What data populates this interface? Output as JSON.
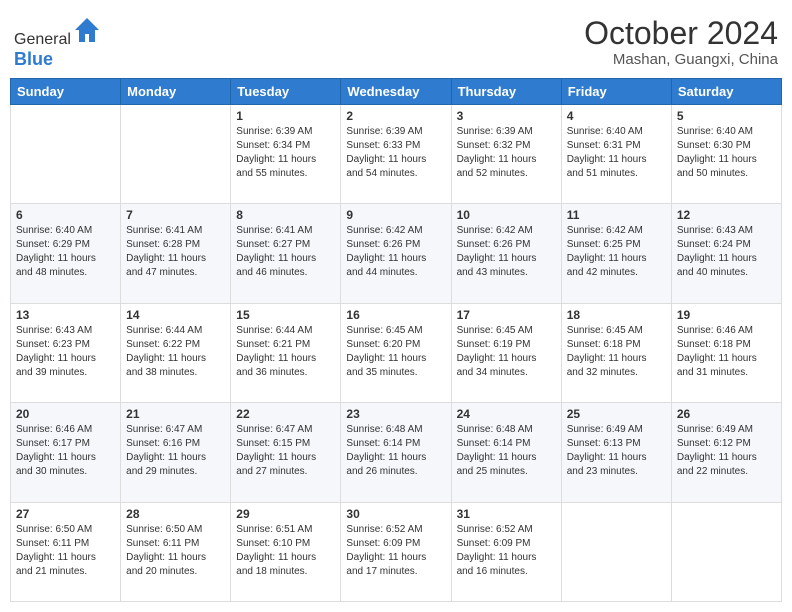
{
  "header": {
    "logo_general": "General",
    "logo_blue": "Blue",
    "month": "October 2024",
    "location": "Mashan, Guangxi, China"
  },
  "days_of_week": [
    "Sunday",
    "Monday",
    "Tuesday",
    "Wednesday",
    "Thursday",
    "Friday",
    "Saturday"
  ],
  "weeks": [
    [
      {
        "day": "",
        "sunrise": "",
        "sunset": "",
        "daylight": ""
      },
      {
        "day": "",
        "sunrise": "",
        "sunset": "",
        "daylight": ""
      },
      {
        "day": "1",
        "sunrise": "Sunrise: 6:39 AM",
        "sunset": "Sunset: 6:34 PM",
        "daylight": "Daylight: 11 hours and 55 minutes."
      },
      {
        "day": "2",
        "sunrise": "Sunrise: 6:39 AM",
        "sunset": "Sunset: 6:33 PM",
        "daylight": "Daylight: 11 hours and 54 minutes."
      },
      {
        "day": "3",
        "sunrise": "Sunrise: 6:39 AM",
        "sunset": "Sunset: 6:32 PM",
        "daylight": "Daylight: 11 hours and 52 minutes."
      },
      {
        "day": "4",
        "sunrise": "Sunrise: 6:40 AM",
        "sunset": "Sunset: 6:31 PM",
        "daylight": "Daylight: 11 hours and 51 minutes."
      },
      {
        "day": "5",
        "sunrise": "Sunrise: 6:40 AM",
        "sunset": "Sunset: 6:30 PM",
        "daylight": "Daylight: 11 hours and 50 minutes."
      }
    ],
    [
      {
        "day": "6",
        "sunrise": "Sunrise: 6:40 AM",
        "sunset": "Sunset: 6:29 PM",
        "daylight": "Daylight: 11 hours and 48 minutes."
      },
      {
        "day": "7",
        "sunrise": "Sunrise: 6:41 AM",
        "sunset": "Sunset: 6:28 PM",
        "daylight": "Daylight: 11 hours and 47 minutes."
      },
      {
        "day": "8",
        "sunrise": "Sunrise: 6:41 AM",
        "sunset": "Sunset: 6:27 PM",
        "daylight": "Daylight: 11 hours and 46 minutes."
      },
      {
        "day": "9",
        "sunrise": "Sunrise: 6:42 AM",
        "sunset": "Sunset: 6:26 PM",
        "daylight": "Daylight: 11 hours and 44 minutes."
      },
      {
        "day": "10",
        "sunrise": "Sunrise: 6:42 AM",
        "sunset": "Sunset: 6:26 PM",
        "daylight": "Daylight: 11 hours and 43 minutes."
      },
      {
        "day": "11",
        "sunrise": "Sunrise: 6:42 AM",
        "sunset": "Sunset: 6:25 PM",
        "daylight": "Daylight: 11 hours and 42 minutes."
      },
      {
        "day": "12",
        "sunrise": "Sunrise: 6:43 AM",
        "sunset": "Sunset: 6:24 PM",
        "daylight": "Daylight: 11 hours and 40 minutes."
      }
    ],
    [
      {
        "day": "13",
        "sunrise": "Sunrise: 6:43 AM",
        "sunset": "Sunset: 6:23 PM",
        "daylight": "Daylight: 11 hours and 39 minutes."
      },
      {
        "day": "14",
        "sunrise": "Sunrise: 6:44 AM",
        "sunset": "Sunset: 6:22 PM",
        "daylight": "Daylight: 11 hours and 38 minutes."
      },
      {
        "day": "15",
        "sunrise": "Sunrise: 6:44 AM",
        "sunset": "Sunset: 6:21 PM",
        "daylight": "Daylight: 11 hours and 36 minutes."
      },
      {
        "day": "16",
        "sunrise": "Sunrise: 6:45 AM",
        "sunset": "Sunset: 6:20 PM",
        "daylight": "Daylight: 11 hours and 35 minutes."
      },
      {
        "day": "17",
        "sunrise": "Sunrise: 6:45 AM",
        "sunset": "Sunset: 6:19 PM",
        "daylight": "Daylight: 11 hours and 34 minutes."
      },
      {
        "day": "18",
        "sunrise": "Sunrise: 6:45 AM",
        "sunset": "Sunset: 6:18 PM",
        "daylight": "Daylight: 11 hours and 32 minutes."
      },
      {
        "day": "19",
        "sunrise": "Sunrise: 6:46 AM",
        "sunset": "Sunset: 6:18 PM",
        "daylight": "Daylight: 11 hours and 31 minutes."
      }
    ],
    [
      {
        "day": "20",
        "sunrise": "Sunrise: 6:46 AM",
        "sunset": "Sunset: 6:17 PM",
        "daylight": "Daylight: 11 hours and 30 minutes."
      },
      {
        "day": "21",
        "sunrise": "Sunrise: 6:47 AM",
        "sunset": "Sunset: 6:16 PM",
        "daylight": "Daylight: 11 hours and 29 minutes."
      },
      {
        "day": "22",
        "sunrise": "Sunrise: 6:47 AM",
        "sunset": "Sunset: 6:15 PM",
        "daylight": "Daylight: 11 hours and 27 minutes."
      },
      {
        "day": "23",
        "sunrise": "Sunrise: 6:48 AM",
        "sunset": "Sunset: 6:14 PM",
        "daylight": "Daylight: 11 hours and 26 minutes."
      },
      {
        "day": "24",
        "sunrise": "Sunrise: 6:48 AM",
        "sunset": "Sunset: 6:14 PM",
        "daylight": "Daylight: 11 hours and 25 minutes."
      },
      {
        "day": "25",
        "sunrise": "Sunrise: 6:49 AM",
        "sunset": "Sunset: 6:13 PM",
        "daylight": "Daylight: 11 hours and 23 minutes."
      },
      {
        "day": "26",
        "sunrise": "Sunrise: 6:49 AM",
        "sunset": "Sunset: 6:12 PM",
        "daylight": "Daylight: 11 hours and 22 minutes."
      }
    ],
    [
      {
        "day": "27",
        "sunrise": "Sunrise: 6:50 AM",
        "sunset": "Sunset: 6:11 PM",
        "daylight": "Daylight: 11 hours and 21 minutes."
      },
      {
        "day": "28",
        "sunrise": "Sunrise: 6:50 AM",
        "sunset": "Sunset: 6:11 PM",
        "daylight": "Daylight: 11 hours and 20 minutes."
      },
      {
        "day": "29",
        "sunrise": "Sunrise: 6:51 AM",
        "sunset": "Sunset: 6:10 PM",
        "daylight": "Daylight: 11 hours and 18 minutes."
      },
      {
        "day": "30",
        "sunrise": "Sunrise: 6:52 AM",
        "sunset": "Sunset: 6:09 PM",
        "daylight": "Daylight: 11 hours and 17 minutes."
      },
      {
        "day": "31",
        "sunrise": "Sunrise: 6:52 AM",
        "sunset": "Sunset: 6:09 PM",
        "daylight": "Daylight: 11 hours and 16 minutes."
      },
      {
        "day": "",
        "sunrise": "",
        "sunset": "",
        "daylight": ""
      },
      {
        "day": "",
        "sunrise": "",
        "sunset": "",
        "daylight": ""
      }
    ]
  ]
}
